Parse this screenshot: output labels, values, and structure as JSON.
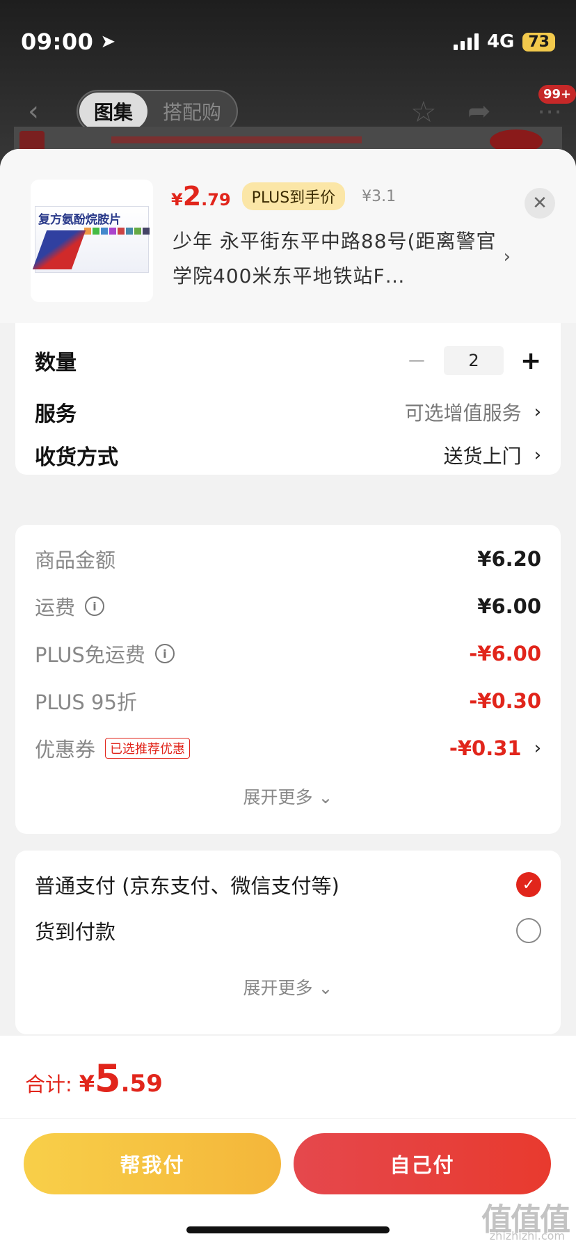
{
  "status_bar": {
    "time": "09:00",
    "network": "4G",
    "battery": "73"
  },
  "top_nav": {
    "tab_active": "图集",
    "tab_inactive": "搭配购",
    "badge": "99+"
  },
  "product": {
    "name": "复方氨酚烷胺片",
    "price_symbol": "¥",
    "price_int": "2",
    "price_dec": ".79",
    "plus_label": "PLUS到手价",
    "original_price": "¥3.1",
    "address": "少年  永平街东平中路88号(距离警官学院400米东平地铁站F…"
  },
  "options": {
    "quantity_label": "数量",
    "quantity_value": "2",
    "service_label": "服务",
    "service_value": "可选增值服务",
    "delivery_label": "收货方式",
    "delivery_value": "送货上门"
  },
  "pricing": {
    "items": [
      {
        "label": "商品金额",
        "value": "¥6.20"
      },
      {
        "label": "运费",
        "value": "¥6.00"
      },
      {
        "label": "PLUS免运费",
        "value": "-¥6.00"
      },
      {
        "label": "PLUS 95折",
        "value": "-¥0.30"
      },
      {
        "label": "优惠券",
        "value": "-¥0.31",
        "badge": "已选推荐优惠"
      }
    ],
    "expand_label": "展开更多"
  },
  "payment": {
    "options": [
      {
        "label": "普通支付 (京东支付、微信支付等)",
        "selected": true
      },
      {
        "label": "货到付款",
        "selected": false
      }
    ],
    "expand_label": "展开更多"
  },
  "footer": {
    "total_label": "合计:",
    "total_symbol": "¥",
    "total_int": "5",
    "total_dec": ".59",
    "help_pay_label": "帮我付",
    "self_pay_label": "自己付"
  },
  "watermark": {
    "logo": "值值值",
    "url": "zhizhizhi.com"
  },
  "colors": {
    "accent_red": "#e1251b",
    "plus_gold": "#fbe6a7",
    "help_btn": "#f6c343",
    "self_btn": "#e6423a"
  }
}
